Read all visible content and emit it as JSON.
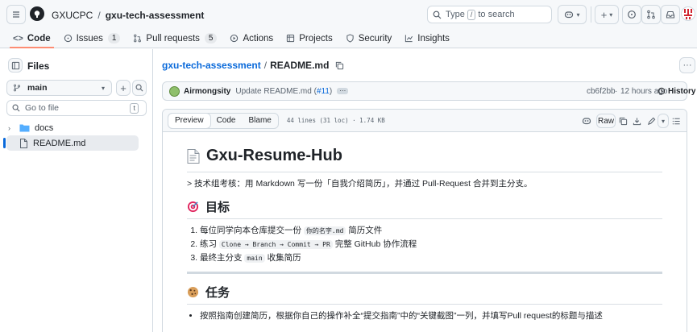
{
  "header": {
    "org": "GXUCPC",
    "separator": "/",
    "repo": "gxu-tech-assessment",
    "search_pre": "Type",
    "search_key": "/",
    "search_post": "to search",
    "plus": "+",
    "caret": "▾"
  },
  "nav": {
    "tabs": [
      {
        "label": "Code",
        "icon": "code-icon"
      },
      {
        "label": "Issues",
        "icon": "issues-icon",
        "count": "1"
      },
      {
        "label": "Pull requests",
        "icon": "pull-request-icon",
        "count": "5"
      },
      {
        "label": "Actions",
        "icon": "actions-icon"
      },
      {
        "label": "Projects",
        "icon": "projects-icon"
      },
      {
        "label": "Security",
        "icon": "shield-icon"
      },
      {
        "label": "Insights",
        "icon": "graph-icon"
      }
    ]
  },
  "sidebar": {
    "title": "Files",
    "branch": "main",
    "goto_placeholder": "Go to file",
    "goto_key": "t",
    "tree": [
      {
        "name": "docs",
        "type": "folder"
      },
      {
        "name": "README.md",
        "type": "file"
      }
    ]
  },
  "file": {
    "repo_link": "gxu-tech-assessment",
    "sep": "/",
    "name": "README.md"
  },
  "commit": {
    "author": "Airmongsity",
    "message": "Update README.md (",
    "pr": "#11",
    "msg_end": ")",
    "sha": "cb6f2bb",
    "dot": "·",
    "time": "12 hours ago",
    "history": "History"
  },
  "viewer": {
    "tabs": [
      "Preview",
      "Code",
      "Blame"
    ],
    "meta": "44 lines (31 loc) · 1.74 KB",
    "raw": "Raw"
  },
  "readme": {
    "title": "Gxu-Resume-Hub",
    "quote": "> 技术组考核：用 Markdown 写一份「自我介绍简历」，并通过 Pull-Request 合并到主分支。",
    "goal_heading": "目标",
    "goals": [
      {
        "pre": "每位同学向本仓库提交一份",
        "code": "你的名字.md",
        "post": "简历文件"
      },
      {
        "pre": "练习",
        "code": "Clone → Branch → Commit → PR",
        "post": "完整 GitHub 协作流程"
      },
      {
        "pre": "最终主分支",
        "code": "main",
        "post": "收集简历"
      }
    ],
    "task_heading": "任务",
    "task_first": "按照指南创建简历，根据你自己的操作补全“提交指南”中的“关键截图”一列，并填写Pull request的标题与描述"
  }
}
